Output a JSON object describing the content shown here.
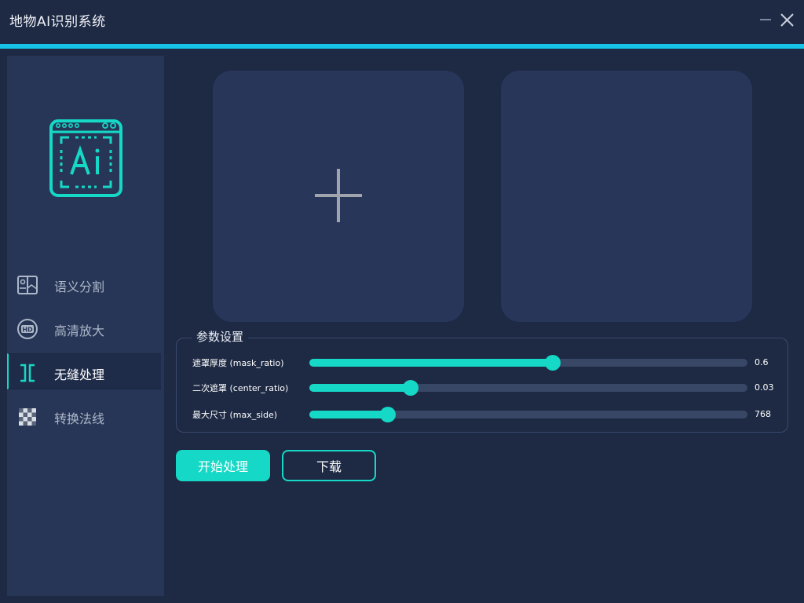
{
  "window": {
    "title": "地物AI识别系统",
    "minimize_icon": "minimize-icon",
    "close_icon": "close-icon"
  },
  "colors": {
    "background": "#1e2a44",
    "sidebar": "#273657",
    "accent_line": "#15c3e6",
    "accent": "#15d9c6",
    "panel": "#28365a"
  },
  "sidebar": {
    "logo_icon": "ai-logo-icon",
    "items": [
      {
        "label": "语义分割",
        "icon": "image-segment-icon",
        "active": false
      },
      {
        "label": "高清放大",
        "icon": "hd-icon",
        "active": false
      },
      {
        "label": "无缝处理",
        "icon": "seamless-icon",
        "active": true
      },
      {
        "label": "转换法线",
        "icon": "checkerboard-icon",
        "active": false
      }
    ]
  },
  "panels": {
    "input_icon": "plus-icon"
  },
  "params": {
    "title": "参数设置",
    "sliders": [
      {
        "label": "遮罩厚度 (mask_ratio)",
        "value": "0.6",
        "fraction": 0.555
      },
      {
        "label": "二次遮罩 (center_ratio)",
        "value": "0.03",
        "fraction": 0.232
      },
      {
        "label": "最大尺寸 (max_side)",
        "value": "768",
        "fraction": 0.179
      }
    ]
  },
  "actions": {
    "start_label": "开始处理",
    "download_label": "下载"
  }
}
